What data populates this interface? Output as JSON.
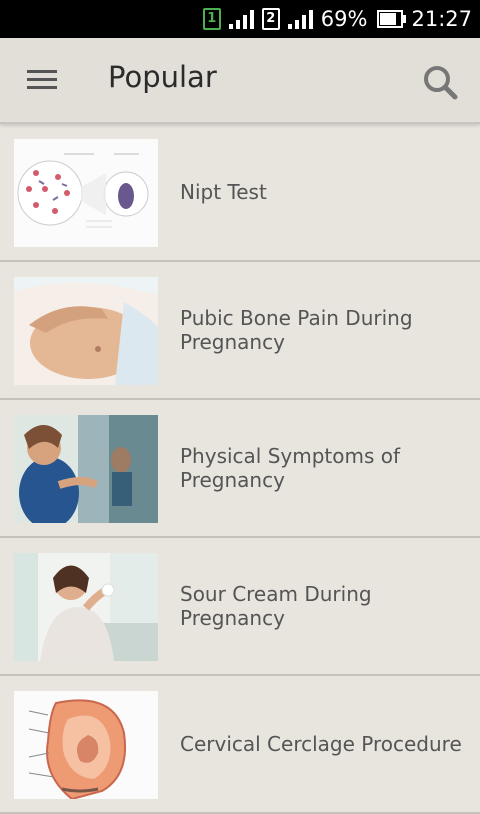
{
  "status_bar": {
    "sim1": "1",
    "sim2": "2",
    "battery": "69%",
    "time": "21:27"
  },
  "app_bar": {
    "title": "Popular"
  },
  "items": [
    {
      "label": "Nipt Test"
    },
    {
      "label": "Pubic Bone Pain During Pregnancy"
    },
    {
      "label": "Physical Symptoms of Pregnancy"
    },
    {
      "label": "Sour Cream During Pregnancy"
    },
    {
      "label": "Cervical Cerclage Procedure"
    }
  ]
}
